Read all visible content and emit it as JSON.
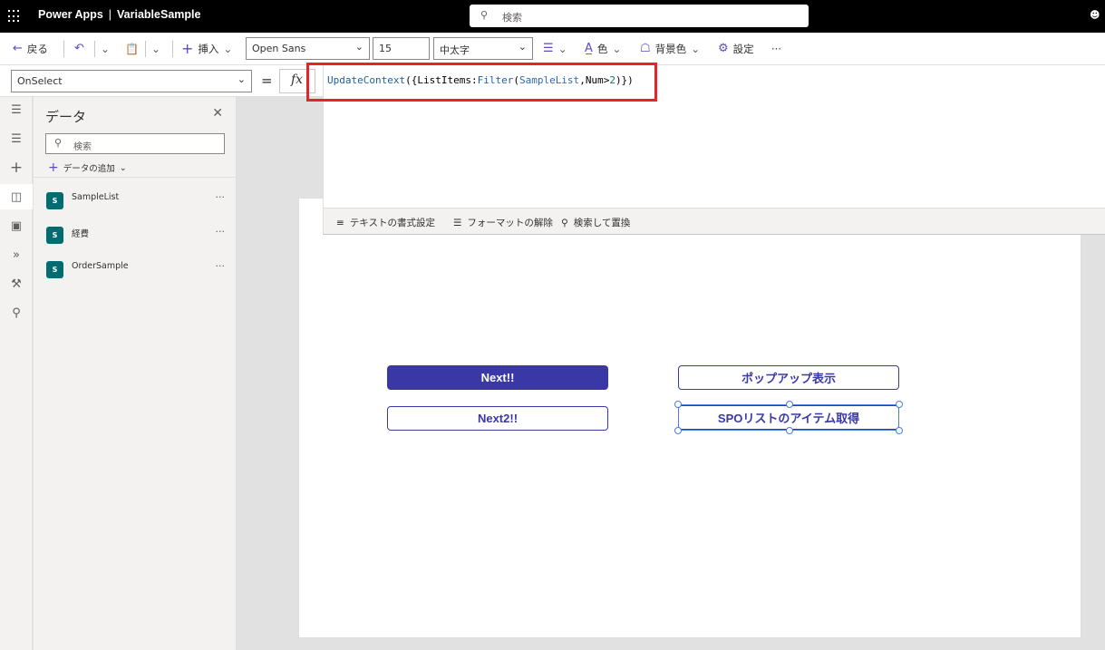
{
  "topbar": {
    "app_name": "Power Apps",
    "separator": "|",
    "app_file": "VariableSample",
    "search_placeholder": "検索"
  },
  "cmdbar": {
    "back": "戻る",
    "insert": "挿入",
    "font_family": "Open Sans",
    "font_size": "15",
    "font_weight": "中太字",
    "color": "色",
    "fill": "背景色",
    "settings": "設定",
    "more": "···"
  },
  "formula": {
    "property": "OnSelect",
    "equals": "=",
    "fx": "fx",
    "code_tokens": [
      {
        "t": "UpdateContext",
        "c": "fn"
      },
      {
        "t": "({",
        "c": ""
      },
      {
        "t": "ListItems",
        "c": ""
      },
      {
        "t": ":",
        "c": ""
      },
      {
        "t": "Filter",
        "c": "fn"
      },
      {
        "t": "(",
        "c": ""
      },
      {
        "t": "SampleList",
        "c": "id"
      },
      {
        "t": ",",
        "c": ""
      },
      {
        "t": "Num",
        "c": ""
      },
      {
        "t": ">",
        "c": ""
      },
      {
        "t": "2",
        "c": "num"
      },
      {
        "t": ")})",
        "c": ""
      }
    ],
    "tools": {
      "format_text": "テキストの書式設定",
      "remove_format": "フォーマットの解除",
      "find_replace": "検索して置換"
    }
  },
  "panel": {
    "title": "データ",
    "search_placeholder": "検索",
    "add_data": "データの追加",
    "items": [
      {
        "label": "SampleList",
        "more": "···"
      },
      {
        "label": "経費",
        "more": "···"
      },
      {
        "label": "OrderSample",
        "more": "···"
      }
    ]
  },
  "canvas": {
    "buttons": {
      "next": "Next!!",
      "next2": "Next2!!",
      "popup": "ポップアップ表示",
      "spo": "SPOリストのアイテム取得"
    }
  },
  "colors": {
    "accent": "#3a38a6",
    "highlight": "#e0262c",
    "selection": "#4a7ce0",
    "icon_purple": "#5f4bbe"
  },
  "icons": {
    "app_launcher": "waffle-icon",
    "search": "search-icon",
    "back": "back-arrow-icon",
    "undo": "undo-icon",
    "paste": "paste-icon",
    "insert": "plus-icon",
    "align": "align-icon",
    "font_color": "font-color-icon",
    "fill": "fill-icon",
    "settings": "gear-icon"
  }
}
